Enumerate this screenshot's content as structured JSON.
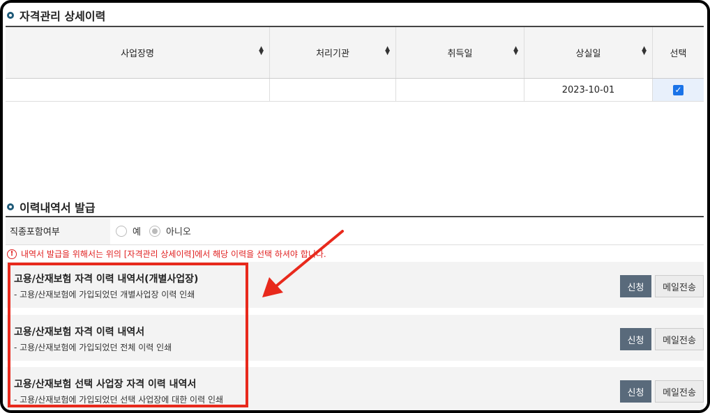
{
  "section1": {
    "title": "자격관리 상세이력"
  },
  "table": {
    "headers": [
      "사업장명",
      "처리기관",
      "취득일",
      "상실일",
      "선택"
    ],
    "rows": [
      {
        "workplace": "",
        "agency": "",
        "acquired": "",
        "lost": "2023-10-01",
        "selected": true
      }
    ]
  },
  "section2": {
    "title": "이력내역서 발급"
  },
  "option": {
    "label": "직종포함여부",
    "yes_label": "예",
    "no_label": "아니오",
    "selected": "no"
  },
  "notice": {
    "icon": "!",
    "text": "내역서 발급을 위해서는 위의 [자격관리 상세이력]에서 해당 이력을 선택 하셔야 합니다."
  },
  "items": [
    {
      "title": "고용/산재보험 자격 이력 내역서(개별사업장)",
      "desc": "- 고용/산재보험에 가입되었던 개별사업장 이력 인쇄"
    },
    {
      "title": "고용/산재보험 자격 이력 내역서",
      "desc": "- 고용/산재보험에 가입되었던 전체 이력 인쇄"
    },
    {
      "title": "고용/산재보험 선택 사업장 자격 이력 내역서",
      "desc": "- 고용/산재보험에 가입되었던 선택 사업장에 대한 이력 인쇄"
    }
  ],
  "buttons": {
    "apply": "신청",
    "mail": "메일전송"
  },
  "colors": {
    "annotation": "#e8291c",
    "apply_bg": "#596a7b",
    "checkbox": "#1a73e8"
  }
}
